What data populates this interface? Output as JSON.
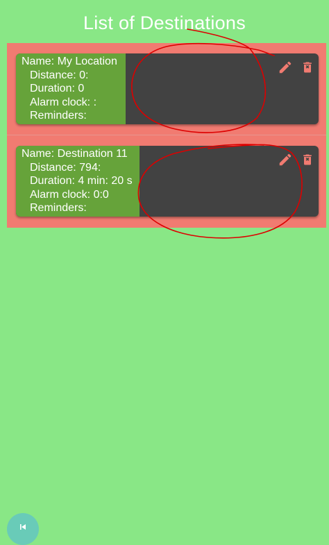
{
  "header": {
    "title": "List of Destinations"
  },
  "destinations": [
    {
      "name": "Name: My Location",
      "distance": "Distance: 0:",
      "duration": "Duration: 0",
      "alarm": "Alarm clock: :",
      "reminders": "Reminders:"
    },
    {
      "name": "Name: Destination 11",
      "distance": "Distance: 794:",
      "duration": "Duration: 4 min: 20 s",
      "alarm": "Alarm clock: 0:0",
      "reminders": "Reminders:"
    }
  ],
  "icons": {
    "edit": "pencil-icon",
    "delete": "trash-icon",
    "fab": "back-icon"
  },
  "colors": {
    "background": "#89e786",
    "item_background": "#f17b71",
    "card_background": "#424242",
    "info_background": "#66a33a",
    "annotation": "#dd0000"
  }
}
